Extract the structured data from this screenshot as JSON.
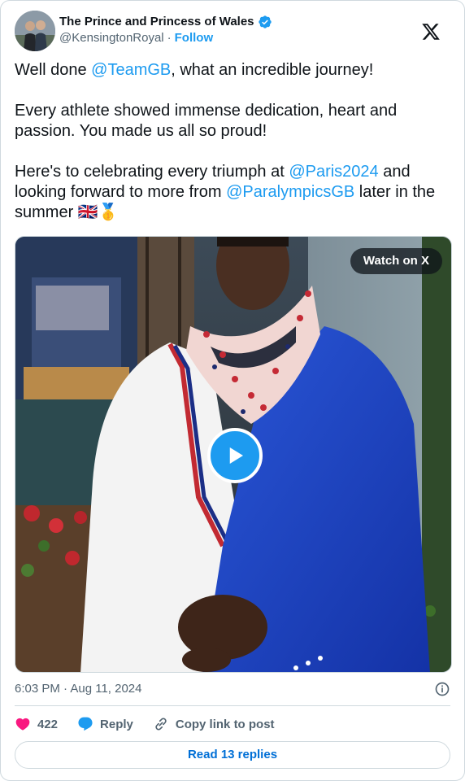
{
  "author": {
    "name": "The Prince and Princess of Wales",
    "handle": "@KensingtonRoyal",
    "separator": "·",
    "follow_label": "Follow"
  },
  "tweet": {
    "line1_prefix": "Well done ",
    "line1_mention": "@TeamGB",
    "line1_suffix": ", what an incredible journey!",
    "para2": "Every athlete showed immense dedication, heart and passion. You made us all so proud!",
    "para3_prefix": "Here's to celebrating every triumph at ",
    "para3_mention1": "@Paris2024",
    "para3_middle": " and looking forward to more from ",
    "para3_mention2": "@ParalympicsGB",
    "para3_suffix": " later in the summer 🇬🇧🥇"
  },
  "media": {
    "watch_label": "Watch on X"
  },
  "meta": {
    "timestamp": "6:03 PM · Aug 11, 2024"
  },
  "actions": {
    "like_count": "422",
    "reply_label": "Reply",
    "copy_label": "Copy link to post"
  },
  "footer": {
    "read_replies_label": "Read 13 replies"
  },
  "colors": {
    "accent": "#1d9bf0",
    "like": "#f91880",
    "text": "#0f1419",
    "muted": "#536471"
  }
}
